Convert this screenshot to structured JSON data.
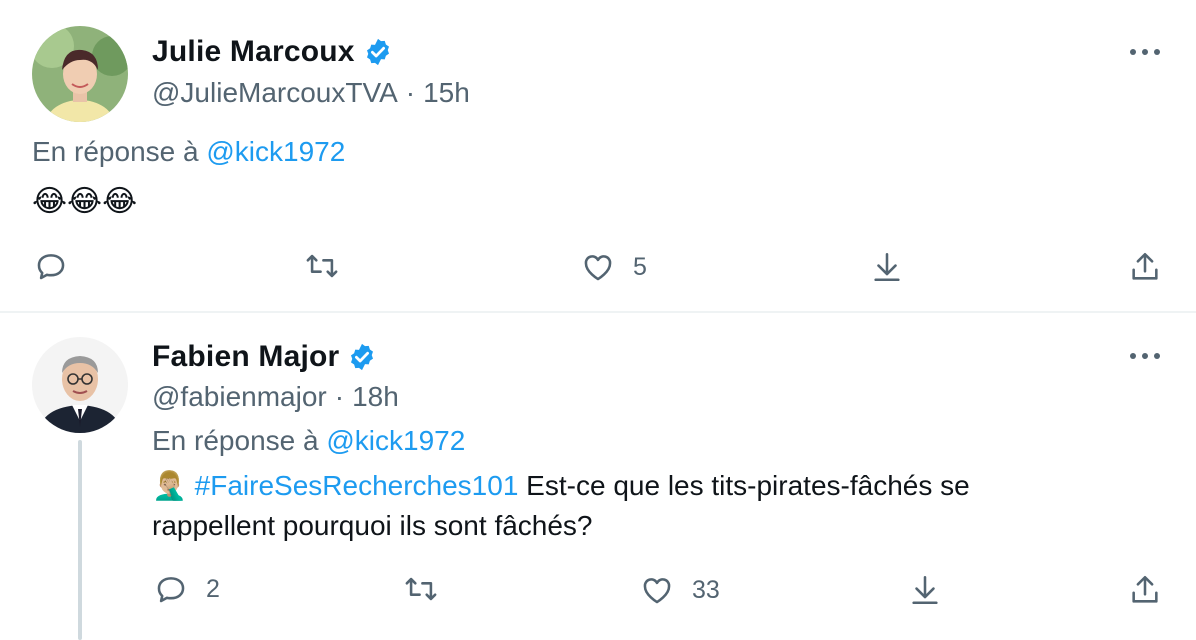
{
  "tweets": [
    {
      "display_name": "Julie Marcoux",
      "handle": "@JulieMarcouxTVA",
      "separator": "·",
      "time": "15h",
      "reply_prefix": "En réponse à",
      "reply_handle": "@kick1972",
      "text": "😂😂😂",
      "actions": {
        "reply_count": "",
        "retweet_count": "",
        "like_count": "5"
      },
      "verified": true
    },
    {
      "display_name": "Fabien Major",
      "handle": "@fabienmajor",
      "separator": "·",
      "time": "18h",
      "reply_prefix": "En réponse à",
      "reply_handle": "@kick1972",
      "emoji": "🤦🏼‍♂️",
      "hashtag": "#FaireSesRecherches101",
      "text_line1": " Est-ce que les tits-pirates-fâchés se",
      "text_line2": "rappellent pourquoi ils sont fâchés?",
      "actions": {
        "reply_count": "2",
        "retweet_count": "",
        "like_count": "33"
      },
      "verified": true
    }
  ],
  "colors": {
    "link": "#1d9bf0",
    "secondary_text": "#536471",
    "verified_badge": "#1d9bf0",
    "divider": "#eff3f4"
  },
  "icons": [
    "verified-badge-icon",
    "more-icon",
    "reply-icon",
    "retweet-icon",
    "like-icon",
    "share-icon",
    "upload-icon"
  ]
}
